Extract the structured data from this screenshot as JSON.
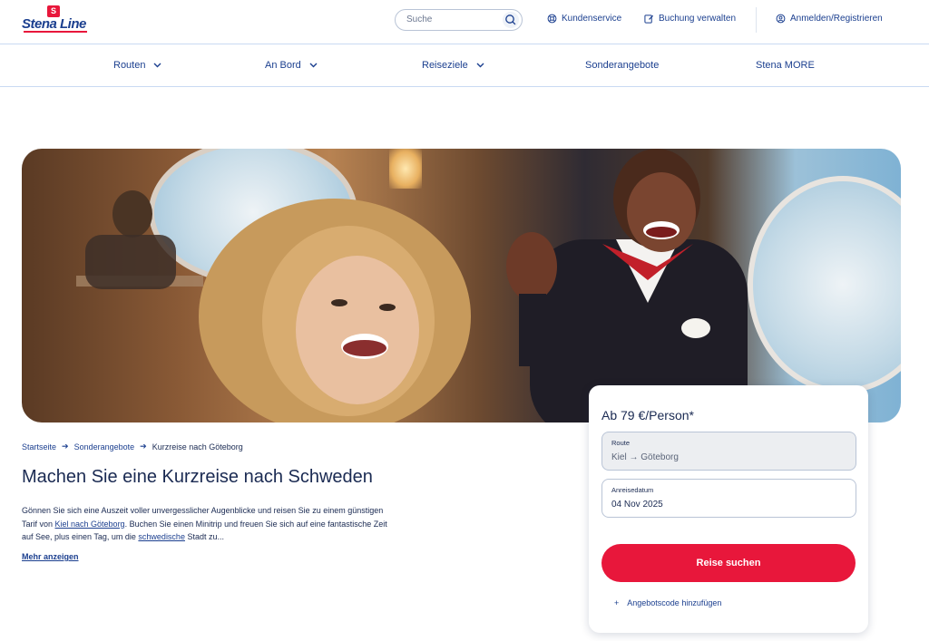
{
  "header": {
    "logo_badge": "S",
    "logo_text": "Stena Line",
    "search_placeholder": "Suche",
    "links": {
      "service": "Kundenservice",
      "booking": "Buchung verwalten",
      "login": "Anmelden/Registrieren"
    }
  },
  "nav": {
    "items": [
      {
        "label": "Routen"
      },
      {
        "label": "An Bord"
      },
      {
        "label": "Reiseziele"
      },
      {
        "label": "Sonderangebote"
      },
      {
        "label": "Stena MORE"
      }
    ]
  },
  "breadcrumb": {
    "home": "Startseite",
    "offers": "Sonderangebote",
    "current": "Kurzreise nach Göteborg"
  },
  "main": {
    "title": "Machen Sie eine Kurzreise nach Schweden",
    "intro_1": "Gönnen Sie sich eine Auszeit voller unvergesslicher Augenblicke und reisen Sie zu einem günstigen Tarif von ",
    "intro_link_1": "Kiel nach Göteborg",
    "intro_2": ". Buchen Sie einen Minitrip und freuen Sie sich auf eine fantastische Zeit auf See, plus einen Tag, um die ",
    "intro_link_2": "schwedische",
    "intro_3": " Stadt zu...",
    "more": "Mehr anzeigen"
  },
  "booking": {
    "price": "Ab 79 €/Person*",
    "route_label": "Route",
    "route_value": "Kiel → Göteborg",
    "date_label": "Anreisedatum",
    "date_value": "04 Nov 2025",
    "search_button": "Reise suchen",
    "promo_plus": "+",
    "promo_label": "Angebotscode hinzufügen"
  },
  "colors": {
    "brand_blue": "#1b3f8f",
    "brand_red": "#e8173b"
  }
}
